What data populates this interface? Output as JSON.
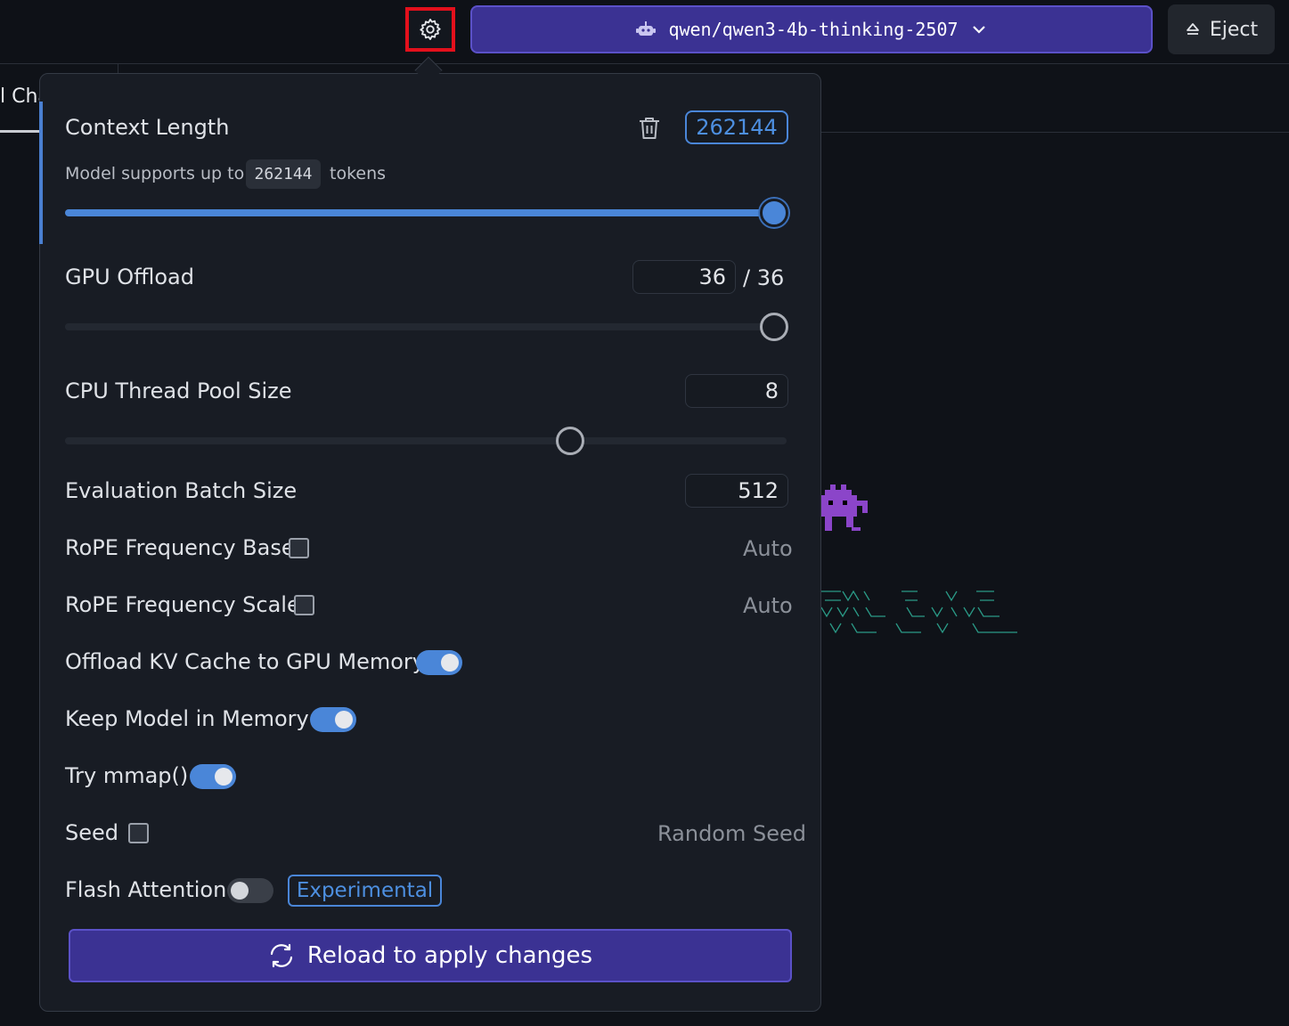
{
  "topbar": {
    "model_name": "qwen/qwen3-4b-thinking-2507",
    "eject_label": "Eject"
  },
  "background": {
    "tab_label": "l Cha"
  },
  "settings": {
    "context_length": {
      "label": "Context Length",
      "value": "262144",
      "supports_prefix": "Model supports up to",
      "supports_value": "262144",
      "supports_suffix": "tokens",
      "slider_fraction": 1.0
    },
    "gpu_offload": {
      "label": "GPU Offload",
      "value": "36",
      "max": "/ 36",
      "slider_fraction": 1.0
    },
    "cpu_thread_pool": {
      "label": "CPU Thread Pool Size",
      "value": "8",
      "slider_fraction": 0.7
    },
    "eval_batch_size": {
      "label": "Evaluation Batch Size",
      "value": "512"
    },
    "rope_base": {
      "label": "RoPE Frequency Base",
      "value": "Auto",
      "checked": false
    },
    "rope_scale": {
      "label": "RoPE Frequency Scale",
      "value": "Auto",
      "checked": false
    },
    "offload_kv": {
      "label": "Offload KV Cache to GPU Memory",
      "enabled": true
    },
    "keep_in_memory": {
      "label": "Keep Model in Memory",
      "enabled": true
    },
    "try_mmap": {
      "label": "Try mmap()",
      "enabled": true
    },
    "seed": {
      "label": "Seed",
      "value": "Random Seed",
      "checked": false
    },
    "flash_attention": {
      "label": "Flash Attention",
      "enabled": false,
      "badge": "Experimental"
    },
    "reload_label": "Reload to apply changes"
  },
  "colors": {
    "accent": "#4a86d8",
    "primary_button": "#3b3293",
    "highlight": "#e3101c"
  },
  "icons": [
    "gear-icon",
    "robot-icon",
    "chevron-down-icon",
    "eject-icon",
    "trash-icon",
    "refresh-icon"
  ]
}
